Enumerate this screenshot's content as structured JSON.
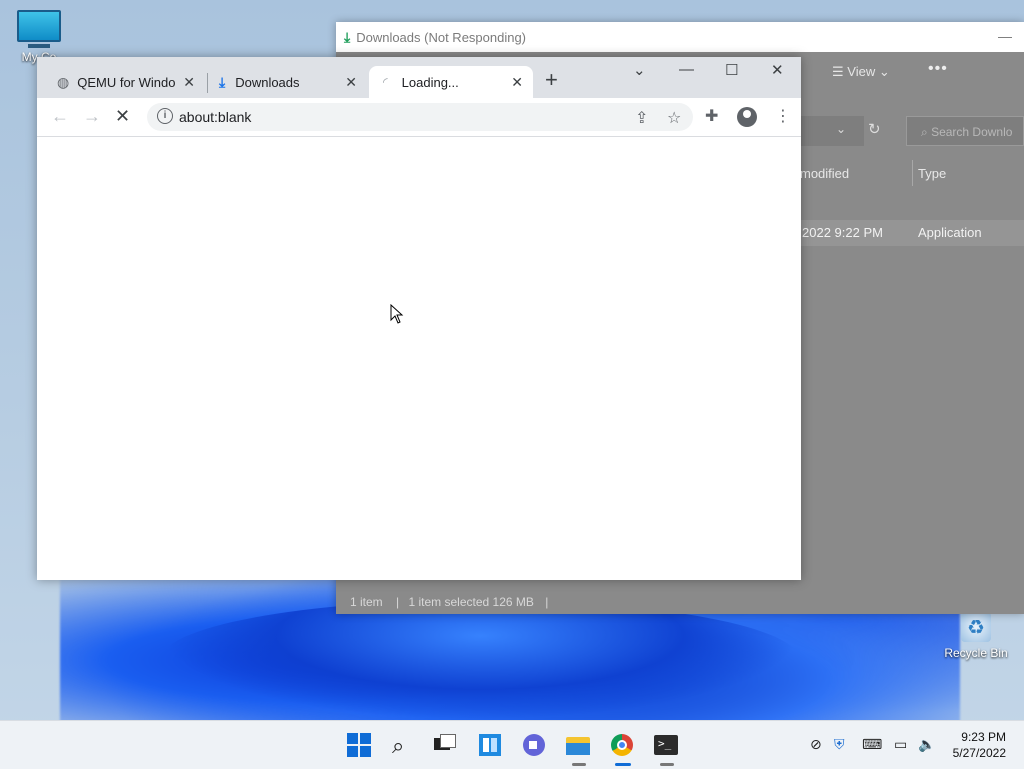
{
  "desktop": {
    "icons": [
      {
        "label": "My Co"
      },
      {
        "label": "Recycle Bin"
      }
    ]
  },
  "explorer": {
    "title": "Downloads (Not Responding)",
    "view_label": "View",
    "search_placeholder": "Search Downlo",
    "columns": {
      "modified": "modified",
      "type": "Type"
    },
    "row": {
      "date": "2022 9:22 PM",
      "type": "Application"
    },
    "status": {
      "items": "1 item",
      "selected": "1 item selected  126 MB"
    }
  },
  "chrome": {
    "tabs": [
      {
        "title": "QEMU for Window"
      },
      {
        "title": "Downloads"
      },
      {
        "title": "Loading..."
      }
    ],
    "address": "about:blank"
  },
  "taskbar": {
    "time": "9:23 PM",
    "date": "5/27/2022"
  }
}
